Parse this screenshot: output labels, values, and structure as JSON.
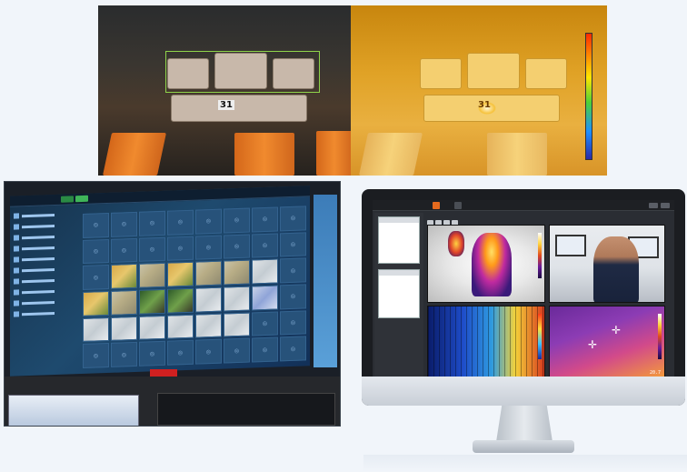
{
  "top_panel": {
    "visible_cam_label": "31",
    "thermal_cam_label": "31"
  },
  "monitor_app": {
    "tabs": [
      {
        "label": "",
        "active": true
      },
      {
        "label": "",
        "active": false
      }
    ],
    "view_number": "20.7"
  },
  "colors": {
    "accent_tab": "#e56a1e",
    "alert_badge": "#d02020",
    "wall_button": "#3fb559"
  },
  "icons": [
    "crosshair-icon",
    "camera-icon",
    "window-button-icon"
  ]
}
